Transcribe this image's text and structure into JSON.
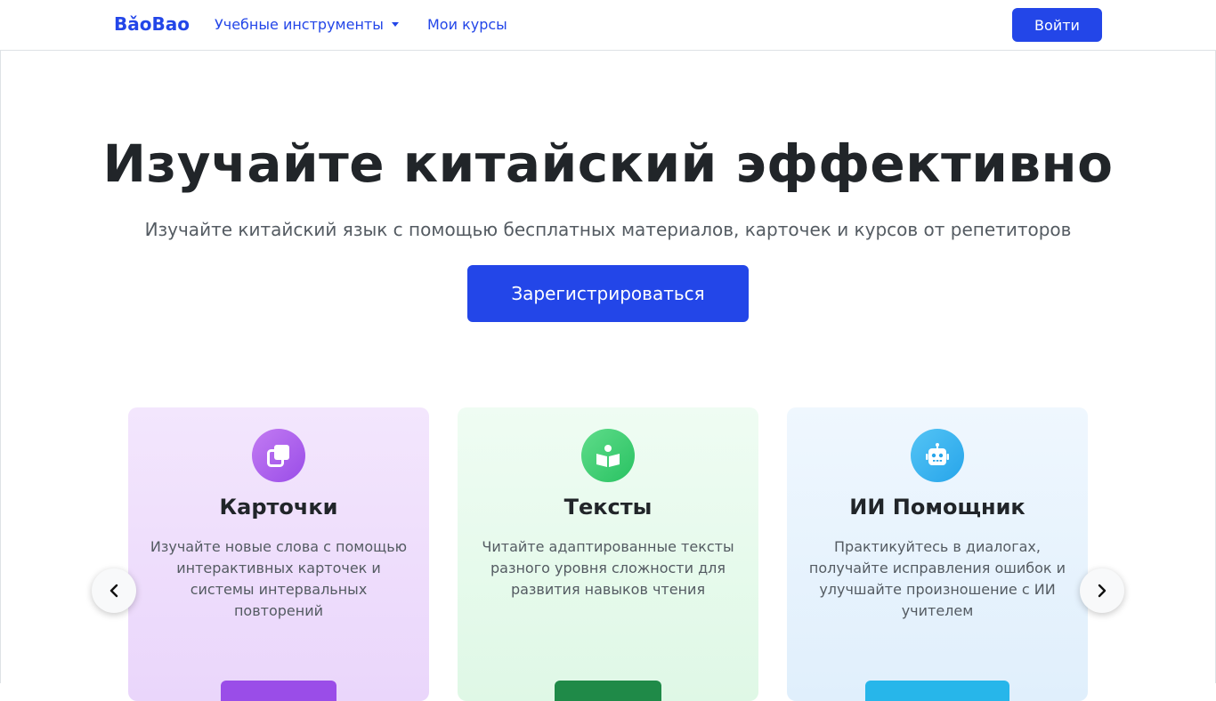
{
  "navbar": {
    "brand": "BǎoBao",
    "tools_label": "Учебные инструменты",
    "courses_label": "Мои курсы",
    "login_label": "Войти"
  },
  "hero": {
    "title": "Изучайте китайский эффективно",
    "subtitle": "Изучайте китайский язык с помощью бесплатных материалов, карточек и курсов от репетиторов",
    "signup_label": "Зарегистрироваться"
  },
  "carousel": {
    "cards": [
      {
        "title": "Карточки",
        "text": "Изучайте новые слова с помощью интерактивных карточек и системы интервальных повторений",
        "icon": "cards-icon",
        "color": "#9a4de8"
      },
      {
        "title": "Тексты",
        "text": "Читайте адаптированные тексты разного уровня сложности для развития навыков чтения",
        "icon": "book-reader-icon",
        "color": "#29c262"
      },
      {
        "title": "ИИ Помощник",
        "text": "Практикуйтесь в диалогах, получайте исправления ошибок и улучшайте произношение с ИИ учителем",
        "icon": "robot-icon",
        "color": "#27a5ea"
      }
    ]
  },
  "colors": {
    "accent": "#2346e8"
  }
}
